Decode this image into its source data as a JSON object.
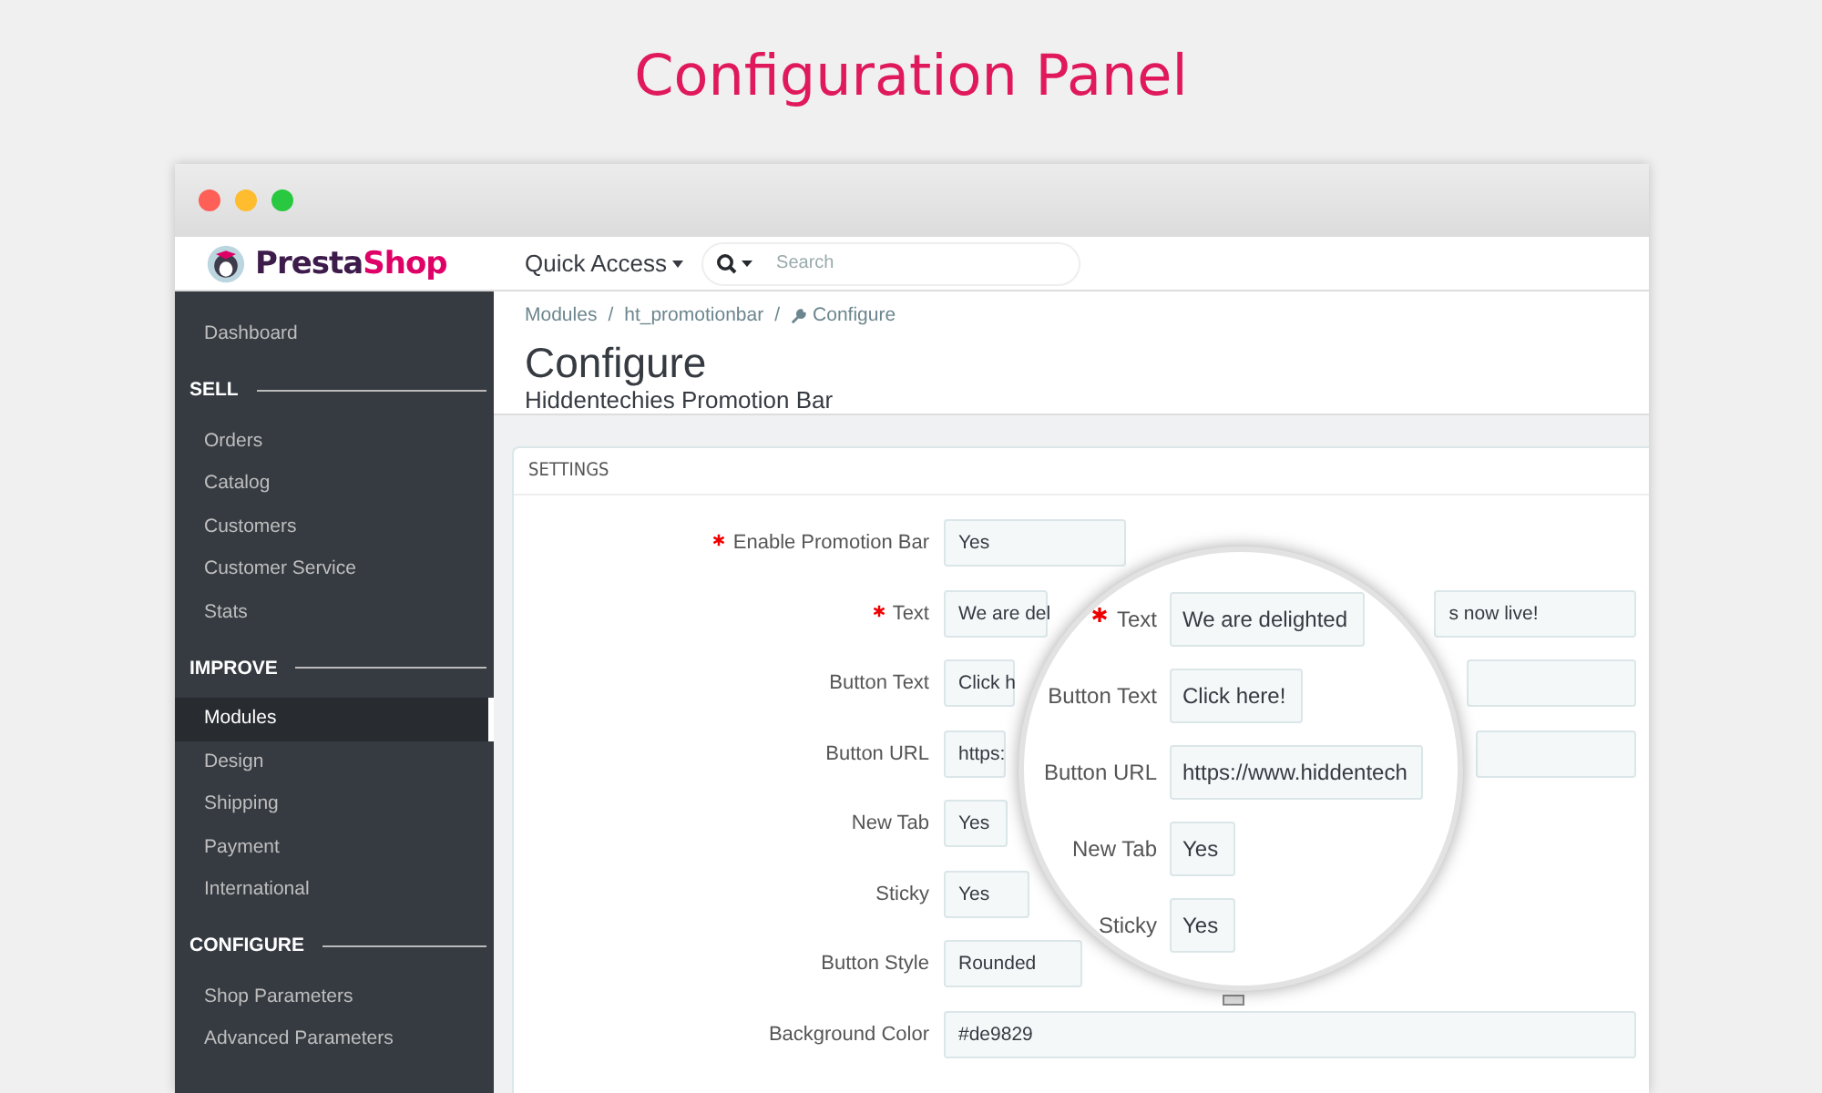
{
  "page_title": "Configuration Panel",
  "window": {
    "buttons": [
      {
        "color": "#fe5f57"
      },
      {
        "color": "#febc2e"
      },
      {
        "color": "#28c840"
      }
    ]
  },
  "header": {
    "logo": [
      "Presta",
      "Shop"
    ],
    "quick_access": "Quick Access",
    "search": {
      "placeholder": "Search"
    }
  },
  "sidebar": {
    "items": [
      {
        "kind": "item",
        "label": "Dashboard",
        "selected": false
      },
      {
        "kind": "section",
        "label": "SELL"
      },
      {
        "kind": "item",
        "label": "Orders",
        "selected": false
      },
      {
        "kind": "item",
        "label": "Catalog",
        "selected": false
      },
      {
        "kind": "item",
        "label": "Customers",
        "selected": false
      },
      {
        "kind": "item",
        "label": "Customer Service",
        "selected": false
      },
      {
        "kind": "item",
        "label": "Stats",
        "selected": false
      },
      {
        "kind": "section",
        "label": "IMPROVE"
      },
      {
        "kind": "item",
        "label": "Modules",
        "selected": true
      },
      {
        "kind": "item",
        "label": "Design",
        "selected": false
      },
      {
        "kind": "item",
        "label": "Shipping",
        "selected": false
      },
      {
        "kind": "item",
        "label": "Payment",
        "selected": false
      },
      {
        "kind": "item",
        "label": "International",
        "selected": false
      },
      {
        "kind": "section",
        "label": "CONFIGURE"
      },
      {
        "kind": "item",
        "label": "Shop Parameters",
        "selected": false
      },
      {
        "kind": "item",
        "label": "Advanced Parameters",
        "selected": false
      }
    ]
  },
  "breadcrumb": {
    "items": [
      "Modules",
      "ht_promotionbar",
      "Configure"
    ],
    "separator": "/"
  },
  "heading": "Configure",
  "subtitle": "Hiddentechies Promotion Bar",
  "panel": {
    "title": "SETTINGS",
    "rows": [
      {
        "label": "Enable Promotion Bar",
        "required": true,
        "kind": "select",
        "value": "Yes"
      },
      {
        "label": "Text",
        "required": true,
        "kind": "text",
        "value": "We are del",
        "value_end": "s now live!"
      },
      {
        "label": "Button Text",
        "required": false,
        "kind": "text",
        "value": "Click h"
      },
      {
        "label": "Button URL",
        "required": false,
        "kind": "text",
        "value": "https:"
      },
      {
        "label": "New Tab",
        "required": false,
        "kind": "select",
        "value": "Yes"
      },
      {
        "label": "Sticky",
        "required": false,
        "kind": "select",
        "value": "Yes"
      },
      {
        "label": "Button Style",
        "required": false,
        "kind": "dropdown",
        "value": "Rounded"
      },
      {
        "label": "Background Color",
        "required": false,
        "kind": "text",
        "value": "#de9829"
      }
    ]
  },
  "magnifier": {
    "rows": [
      {
        "label": "Text",
        "required": true,
        "value": "We are delighted"
      },
      {
        "label": "Button Text",
        "required": false,
        "value": "Click here!"
      },
      {
        "label": "Button URL",
        "required": false,
        "value": "https://www.hiddentech"
      },
      {
        "label": "New Tab",
        "required": false,
        "value": "Yes"
      },
      {
        "label": "Sticky",
        "required": false,
        "value": "Yes"
      }
    ]
  }
}
